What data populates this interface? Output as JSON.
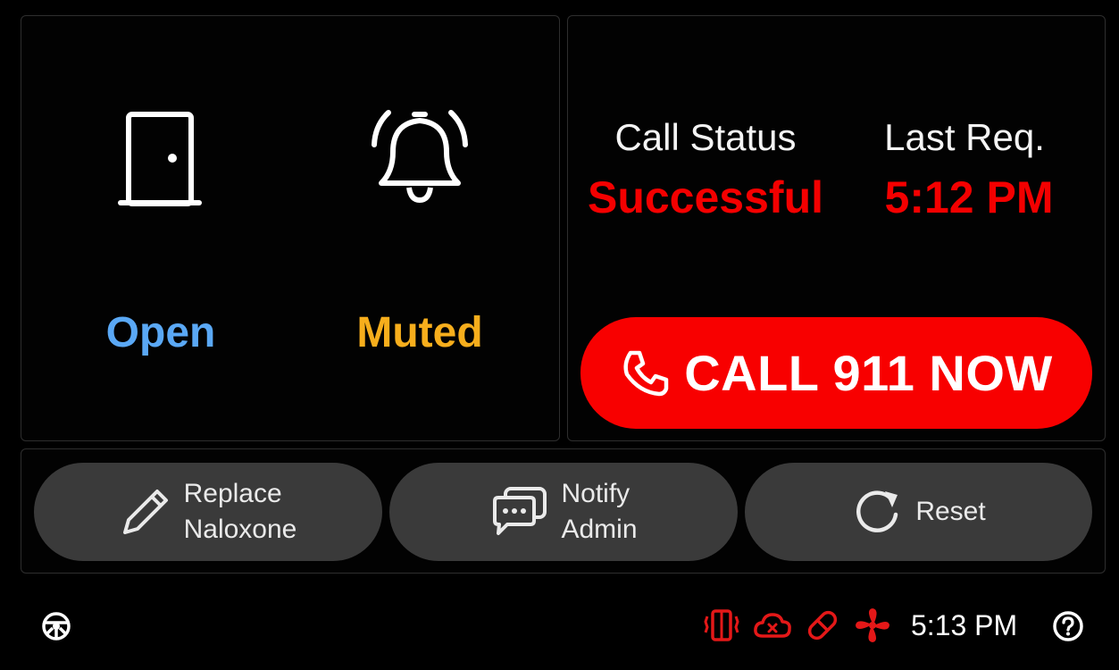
{
  "status": {
    "door": {
      "label": "Open",
      "icon": "door-icon",
      "color": "#5aa8f5"
    },
    "alarm": {
      "label": "Muted",
      "icon": "bell-icon",
      "color": "#f7ae1c"
    }
  },
  "call_info": {
    "status_heading": "Call Status",
    "status_value": "Successful",
    "last_request_heading": "Last Req.",
    "last_request_value": "5:12 PM",
    "value_color": "#f40000"
  },
  "call_button": {
    "label": "CALL 911 NOW",
    "icon": "phone-icon",
    "color": "#f80000"
  },
  "actions": [
    {
      "icon": "pencil-icon",
      "line1": "Replace",
      "line2": "Naloxone"
    },
    {
      "icon": "chat-bubbles-icon",
      "line1": "Notify",
      "line2": "Admin"
    },
    {
      "icon": "reset-icon",
      "line1": "Reset",
      "line2": ""
    }
  ],
  "status_bar": {
    "settings_icon": "steering-wheel-icon",
    "indicators": [
      "vibration-icon",
      "cloud-error-icon",
      "pill-icon",
      "fan-icon"
    ],
    "indicator_color": "#e41818",
    "time": "5:13 PM",
    "help_icon": "help-icon"
  }
}
